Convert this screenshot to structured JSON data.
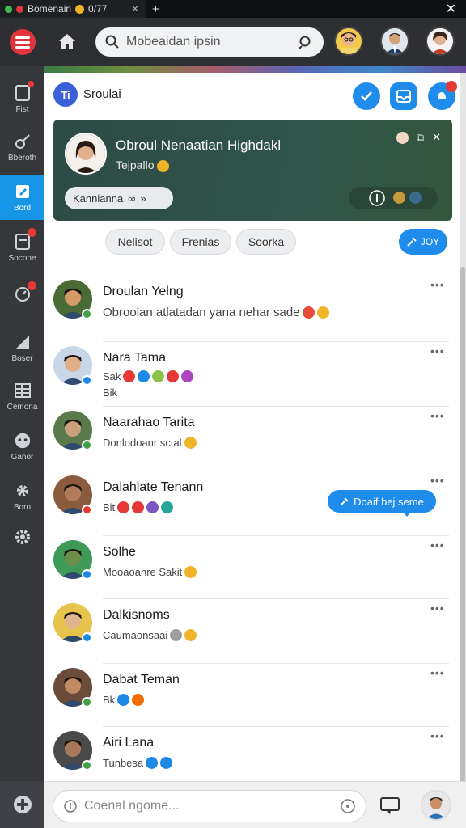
{
  "window": {
    "tab_title": "Bomenain",
    "tab_extra": "0/77",
    "new_tab": "+",
    "close": "✕"
  },
  "topbar": {
    "search_placeholder": "Mobeaidan ipsin"
  },
  "sidebar": {
    "items": [
      {
        "label": "Fist",
        "icon": "note-icon",
        "badge": true
      },
      {
        "label": "Bberoth",
        "icon": "guitar-icon",
        "badge": false
      },
      {
        "label": "Bord",
        "icon": "edit-icon",
        "badge": false,
        "active": true
      },
      {
        "label": "Socone",
        "icon": "document-icon",
        "badge": true
      },
      {
        "label": "",
        "icon": "clock-icon",
        "badge": true
      },
      {
        "label": "Boser",
        "icon": "flag-icon",
        "badge": false
      },
      {
        "label": "Cemona",
        "icon": "table-icon",
        "badge": false
      },
      {
        "label": "Ganor",
        "icon": "gamepad-icon",
        "badge": false
      },
      {
        "label": "Boro",
        "icon": "settings-icon",
        "badge": false
      },
      {
        "label": "",
        "icon": "gear-icon",
        "badge": false
      }
    ]
  },
  "group": {
    "icon_text": "Ti",
    "name": "Sroulai"
  },
  "hero": {
    "title": "Obroul Nenaatian Highdakl",
    "subtitle": "Tejpallo",
    "pill_label": "Kannianna",
    "pill_glyph": "∞",
    "pill_count": "»",
    "ctl_close": "✕",
    "ctl_expand": "⧉"
  },
  "chips": [
    "Nelisot",
    "Frenias",
    "Soorka"
  ],
  "join_label": "JOY",
  "conversations": [
    {
      "name": "Droulan Yelng",
      "sub": "Obroolan atlatadan yana nehar sade",
      "emojis": [
        "#e74c3c",
        "#f0b429"
      ],
      "badge": "#43a047"
    },
    {
      "name": "Nara Tama",
      "sub": "Sak",
      "sub2": "Bik",
      "emojis": [
        "#e53935",
        "#1e88e5",
        "#8bc34a",
        "#e53935",
        "#ab47bc"
      ],
      "badge": "#1e88e5"
    },
    {
      "name": "Naarahao Tarita",
      "sub": "Donlodoanr sctal",
      "emojis": [
        "#f0b429"
      ],
      "badge": "#43a047"
    },
    {
      "name": "Dalahlate Tenann",
      "sub": "Bit",
      "emojis": [
        "#e53935",
        "#e53935",
        "#7e57c2",
        "#26a69a"
      ],
      "badge": "#e53935"
    },
    {
      "name": "Solhe",
      "sub": "Mooaoanre Sakit",
      "emojis": [
        "#f0b429"
      ],
      "badge": "#1e88e5"
    },
    {
      "name": "Dalkisnoms",
      "sub": "Caumaonsaai",
      "emojis": [
        "#9e9e9e",
        "#f0b429"
      ],
      "badge": "#1e88e5"
    },
    {
      "name": "Dabat Teman",
      "sub": "Bk",
      "emojis": [
        "#1e88e5",
        "#ef6c00"
      ],
      "badge": "#43a047"
    },
    {
      "name": "Airi Lana",
      "sub": "Tunbesa",
      "emojis": [
        "#1e88e5",
        "#1e88e5"
      ],
      "badge": "#43a047"
    }
  ],
  "more_glyph": "•••",
  "tooltip_label": "Doaif bej seme",
  "composer": {
    "placeholder": "Coenal ngome..."
  },
  "colors": {
    "accent": "#1f8ceb",
    "sidebar": "#35373b",
    "active": "#1795e6",
    "hero": "#2f544b",
    "danger": "#e0363b"
  }
}
